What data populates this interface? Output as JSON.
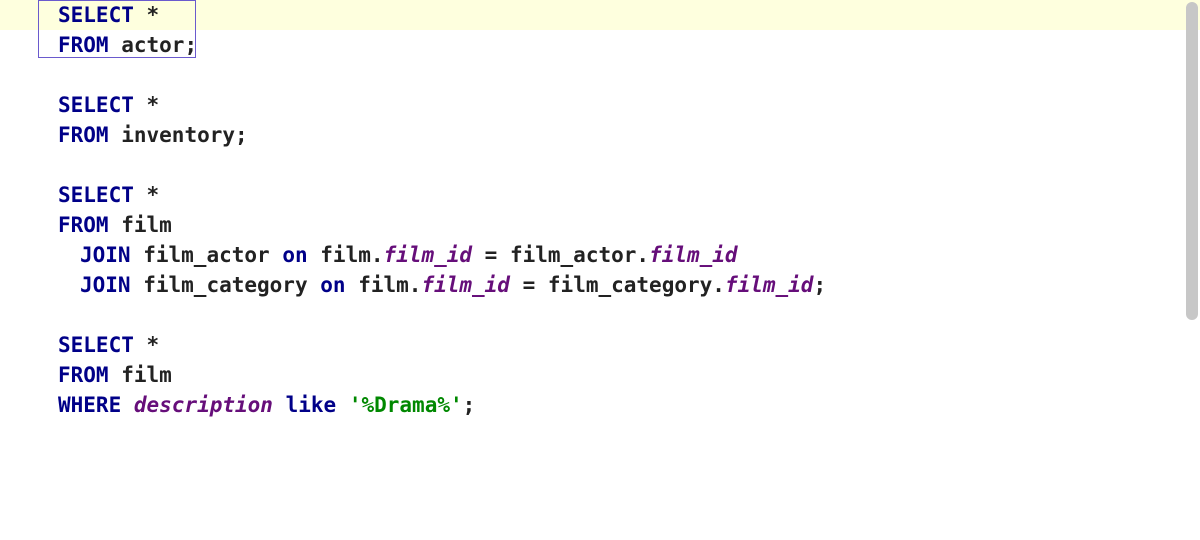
{
  "editor": {
    "lines": [
      {
        "hl": true,
        "cls": "",
        "tokens": [
          {
            "t": "kw",
            "v": "SELECT"
          },
          {
            "t": "punct",
            "v": " "
          },
          {
            "t": "star",
            "v": "*"
          }
        ]
      },
      {
        "hl": false,
        "cls": "",
        "tokens": [
          {
            "t": "kw",
            "v": "FROM"
          },
          {
            "t": "punct",
            "v": " "
          },
          {
            "t": "ident",
            "v": "actor"
          },
          {
            "t": "punct",
            "v": ";"
          }
        ]
      },
      {
        "hl": false,
        "cls": "",
        "tokens": []
      },
      {
        "hl": false,
        "cls": "",
        "tokens": [
          {
            "t": "kw",
            "v": "SELECT"
          },
          {
            "t": "punct",
            "v": " "
          },
          {
            "t": "star",
            "v": "*"
          }
        ]
      },
      {
        "hl": false,
        "cls": "",
        "tokens": [
          {
            "t": "kw",
            "v": "FROM"
          },
          {
            "t": "punct",
            "v": " "
          },
          {
            "t": "ident",
            "v": "inventory"
          },
          {
            "t": "punct",
            "v": ";"
          }
        ]
      },
      {
        "hl": false,
        "cls": "",
        "tokens": []
      },
      {
        "hl": false,
        "cls": "",
        "tokens": [
          {
            "t": "kw",
            "v": "SELECT"
          },
          {
            "t": "punct",
            "v": " "
          },
          {
            "t": "star",
            "v": "*"
          }
        ]
      },
      {
        "hl": false,
        "cls": "",
        "tokens": [
          {
            "t": "kw",
            "v": "FROM"
          },
          {
            "t": "punct",
            "v": " "
          },
          {
            "t": "ident",
            "v": "film"
          }
        ]
      },
      {
        "hl": false,
        "cls": "indent2",
        "tokens": [
          {
            "t": "kw",
            "v": "JOIN"
          },
          {
            "t": "punct",
            "v": " "
          },
          {
            "t": "ident",
            "v": "film_actor"
          },
          {
            "t": "punct",
            "v": " "
          },
          {
            "t": "op-kw",
            "v": "on"
          },
          {
            "t": "punct",
            "v": " "
          },
          {
            "t": "ident",
            "v": "film"
          },
          {
            "t": "punct",
            "v": "."
          },
          {
            "t": "col",
            "v": "film_id"
          },
          {
            "t": "punct",
            "v": " = "
          },
          {
            "t": "ident",
            "v": "film_actor"
          },
          {
            "t": "punct",
            "v": "."
          },
          {
            "t": "col",
            "v": "film_id"
          }
        ]
      },
      {
        "hl": false,
        "cls": "indent2",
        "tokens": [
          {
            "t": "kw",
            "v": "JOIN"
          },
          {
            "t": "punct",
            "v": " "
          },
          {
            "t": "ident",
            "v": "film_category"
          },
          {
            "t": "punct",
            "v": " "
          },
          {
            "t": "op-kw",
            "v": "on"
          },
          {
            "t": "punct",
            "v": " "
          },
          {
            "t": "ident",
            "v": "film"
          },
          {
            "t": "punct",
            "v": "."
          },
          {
            "t": "col",
            "v": "film_id"
          },
          {
            "t": "punct",
            "v": " = "
          },
          {
            "t": "ident",
            "v": "film_category"
          },
          {
            "t": "punct",
            "v": "."
          },
          {
            "t": "col",
            "v": "film_id"
          },
          {
            "t": "punct",
            "v": ";"
          }
        ]
      },
      {
        "hl": false,
        "cls": "",
        "tokens": []
      },
      {
        "hl": false,
        "cls": "",
        "tokens": [
          {
            "t": "kw",
            "v": "SELECT"
          },
          {
            "t": "punct",
            "v": " "
          },
          {
            "t": "star",
            "v": "*"
          }
        ]
      },
      {
        "hl": false,
        "cls": "",
        "tokens": [
          {
            "t": "kw",
            "v": "FROM"
          },
          {
            "t": "punct",
            "v": " "
          },
          {
            "t": "ident",
            "v": "film"
          }
        ]
      },
      {
        "hl": false,
        "cls": "",
        "tokens": [
          {
            "t": "kw",
            "v": "WHERE"
          },
          {
            "t": "punct",
            "v": " "
          },
          {
            "t": "col",
            "v": "description"
          },
          {
            "t": "punct",
            "v": " "
          },
          {
            "t": "op-kw",
            "v": "like"
          },
          {
            "t": "punct",
            "v": " "
          },
          {
            "t": "str",
            "v": "'%Drama%'"
          },
          {
            "t": "punct",
            "v": ";"
          }
        ]
      }
    ]
  }
}
